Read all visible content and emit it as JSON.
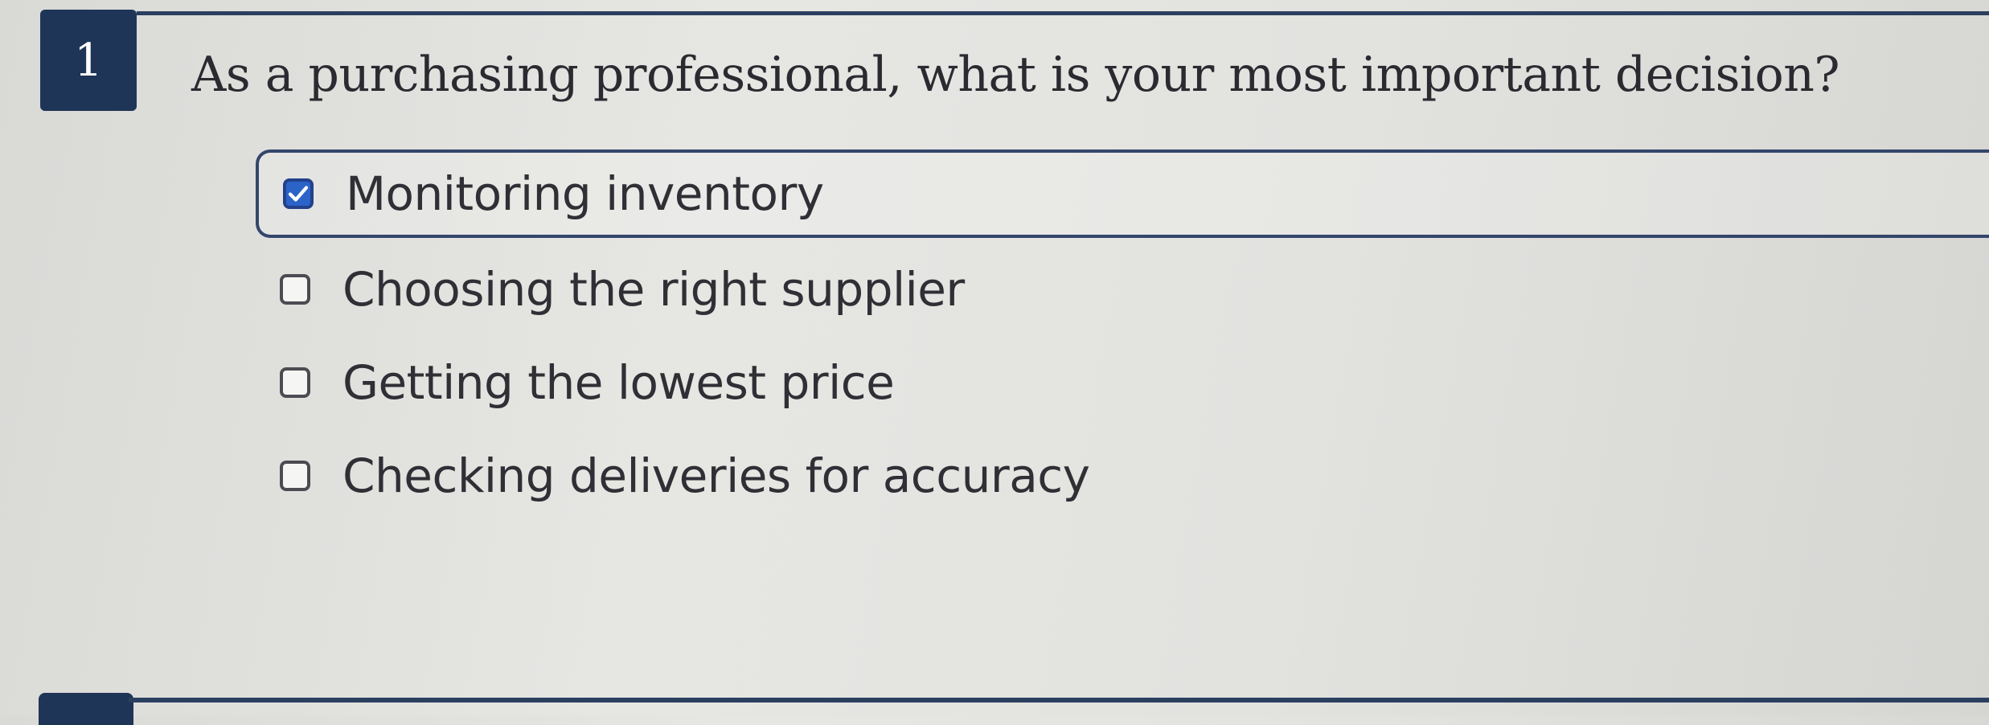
{
  "question": {
    "number": "1",
    "text": "As a purchasing professional, what is your most important decision?"
  },
  "options": [
    {
      "label": "Monitoring inventory",
      "checked": true
    },
    {
      "label": "Choosing the right supplier",
      "checked": false
    },
    {
      "label": "Getting the lowest price",
      "checked": false
    },
    {
      "label": "Checking deliveries for accuracy",
      "checked": false
    }
  ],
  "colors": {
    "badge": "#1f3557",
    "checkbox_checked": "#2c63c9",
    "selected_border": "#34466a",
    "background": "#e2e2df"
  },
  "icons": {
    "checked": "check-icon"
  }
}
